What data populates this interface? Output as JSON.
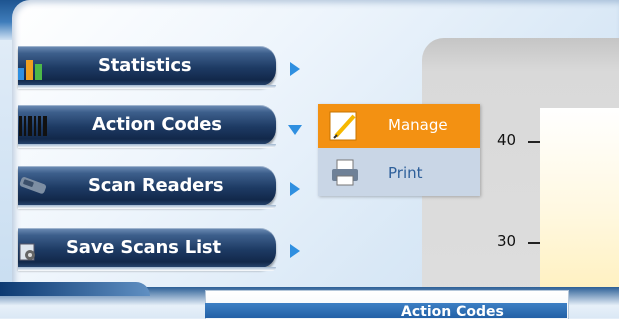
{
  "menu": {
    "items": [
      {
        "label": "Statistics",
        "icon": "bar-chart-icon",
        "arrow": "right"
      },
      {
        "label": "Action Codes",
        "icon": "barcode-icon",
        "arrow": "down"
      },
      {
        "label": "Scan Readers",
        "icon": "scanner-icon",
        "arrow": "right"
      },
      {
        "label": "Save Scans List",
        "icon": "save-list-icon",
        "arrow": "right"
      }
    ]
  },
  "submenu": {
    "items": [
      {
        "label": "Manage",
        "icon": "pencil-icon",
        "state": "selected"
      },
      {
        "label": "Print",
        "icon": "printer-icon",
        "state": "normal"
      }
    ],
    "colors": {
      "selected_bg": "#f39112",
      "normal_text": "#2d5f9a"
    }
  },
  "chart": {
    "y_ticks": [
      "40",
      "30"
    ]
  },
  "bottom": {
    "title": "Action Codes"
  },
  "colors": {
    "accent_arrow": "#2f8fe0",
    "menu_pill": "#1d3a63"
  }
}
